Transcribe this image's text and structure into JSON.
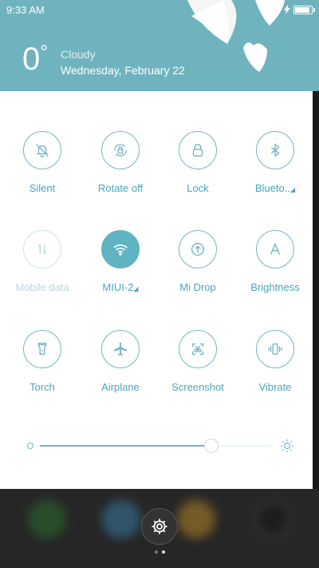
{
  "status_bar": {
    "time": "9:33 AM",
    "battery_level": 0.8
  },
  "weather": {
    "temperature": "0",
    "degree": "°",
    "condition": "Cloudy",
    "date": "Wednesday, February 22"
  },
  "toggles": [
    {
      "label": "Silent",
      "icon": "silent-bell-icon"
    },
    {
      "label": "Rotate off",
      "icon": "rotate-lock-icon"
    },
    {
      "label": "Lock",
      "icon": "lock-icon"
    },
    {
      "label": "Blueto..",
      "icon": "bluetooth-icon"
    },
    {
      "label": "Mobile data",
      "icon": "mobile-data-icon",
      "state": "disabled"
    },
    {
      "label": "MIUI-2",
      "icon": "wifi-icon",
      "state": "on"
    },
    {
      "label": "Mi Drop",
      "icon": "mi-drop-icon"
    },
    {
      "label": "Brightness",
      "icon": "brightness-auto-icon"
    },
    {
      "label": "Torch",
      "icon": "torch-icon"
    },
    {
      "label": "Airplane",
      "icon": "airplane-icon"
    },
    {
      "label": "Screenshot",
      "icon": "screenshot-icon"
    },
    {
      "label": "Vibrate",
      "icon": "vibrate-icon"
    }
  ],
  "brightness": {
    "level": 0.74
  },
  "colors": {
    "accent": "#5fb3c3",
    "header": "#6fb3bf"
  },
  "dock": {
    "pages": 2,
    "active_page": 1
  }
}
